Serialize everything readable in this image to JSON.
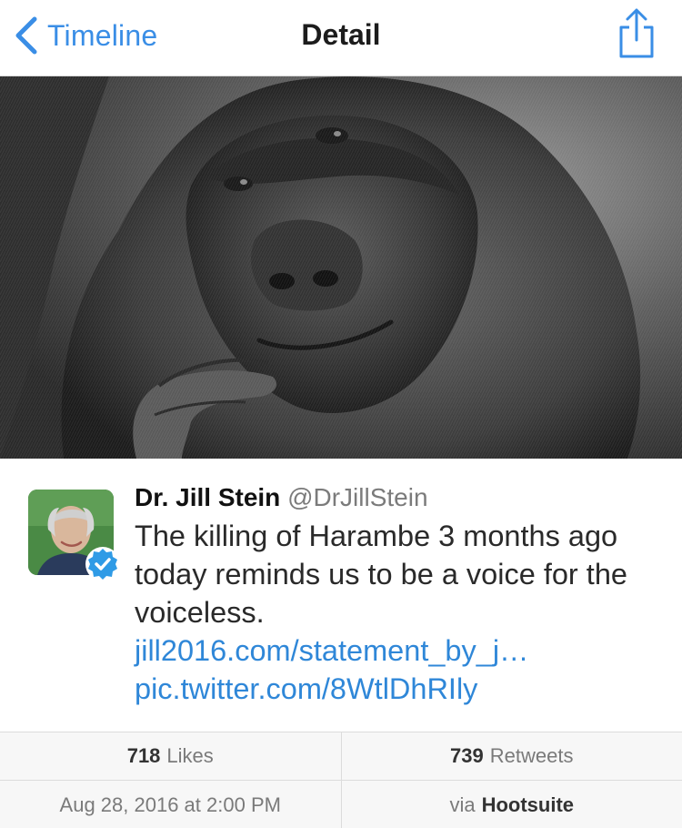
{
  "nav": {
    "back_label": "Timeline",
    "title": "Detail",
    "back_icon": "chevron-left-icon",
    "share_icon": "share-icon"
  },
  "tweet": {
    "author_name": "Dr. Jill Stein",
    "author_handle": "@DrJillStein",
    "verified": true,
    "text": "The killing of Harambe 3 months ago today reminds us to be a voice for the voiceless.",
    "link_1": "jill2016.com/statement_by_j…",
    "link_2": "pic.twitter.com/8WtlDhRIly"
  },
  "stats": {
    "likes_count": "718",
    "likes_label": "Likes",
    "retweets_count": "739",
    "retweets_label": "Retweets",
    "timestamp": "Aug 28, 2016 at 2:00 PM",
    "via_prefix": "via",
    "via_source": "Hootsuite"
  },
  "colors": {
    "accent": "#3a8ee6",
    "link": "#2f87d8",
    "verified_badge": "#2f9be6"
  }
}
